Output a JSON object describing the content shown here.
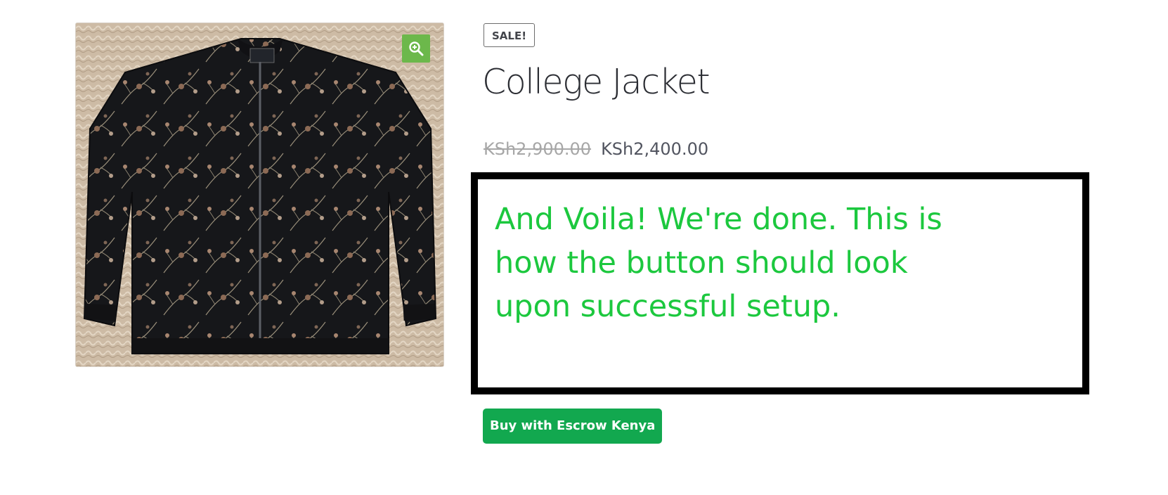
{
  "product": {
    "sale_badge": "SALE!",
    "title": "College Jacket",
    "price_old": "KSh2,900.00",
    "price_new": "KSh2,400.00",
    "image_alt": "College Jacket",
    "zoom_icon": "zoom-in-icon"
  },
  "annotation": {
    "text": "And Voila! We're done. This is how the button should look upon successful setup."
  },
  "buy_button": {
    "label": "Buy with Escrow Kenya"
  },
  "colors": {
    "zoom_button": "#6cb84b",
    "buy_button": "#12a84f",
    "annotation_text": "#1cc83e",
    "annotation_border": "#000000"
  }
}
